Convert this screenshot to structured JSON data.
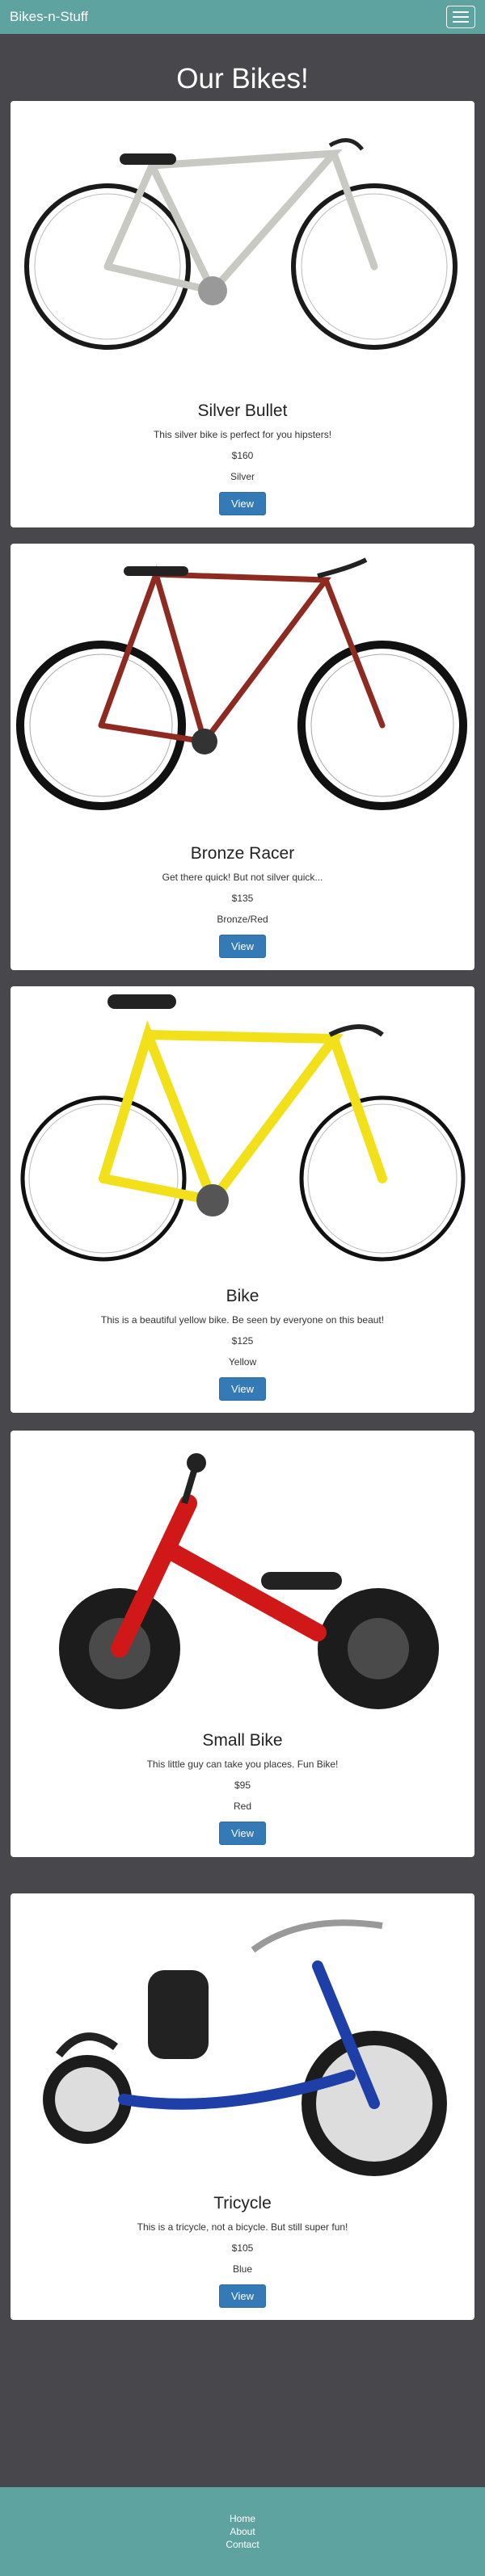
{
  "navbar": {
    "brand": "Bikes-n-Stuff"
  },
  "page": {
    "title": "Our Bikes!"
  },
  "products": [
    {
      "name": "Silver Bullet",
      "description": "This silver bike is perfect for you hipsters!",
      "price": "$160",
      "color": "Silver",
      "button": "View",
      "frame_color": "#c9c9c4"
    },
    {
      "name": "Bronze Racer",
      "description": "Get there quick! But not silver quick...",
      "price": "$135",
      "color": "Bronze/Red",
      "button": "View",
      "frame_color": "#8e2a20"
    },
    {
      "name": "Bike",
      "description": "This is a beautiful yellow bike. Be seen by everyone on this beaut!",
      "price": "$125",
      "color": "Yellow",
      "button": "View",
      "frame_color": "#f2e11a"
    },
    {
      "name": "Small Bike",
      "description": "This little guy can take you places. Fun Bike!",
      "price": "$95",
      "color": "Red",
      "button": "View",
      "frame_color": "#d01818"
    },
    {
      "name": "Tricycle",
      "description": "This is a tricycle, not a bicycle. But still super fun!",
      "price": "$105",
      "color": "Blue",
      "button": "View",
      "frame_color": "#1f3fa8"
    }
  ],
  "footer": {
    "links": [
      "Home",
      "About",
      "Contact"
    ]
  }
}
